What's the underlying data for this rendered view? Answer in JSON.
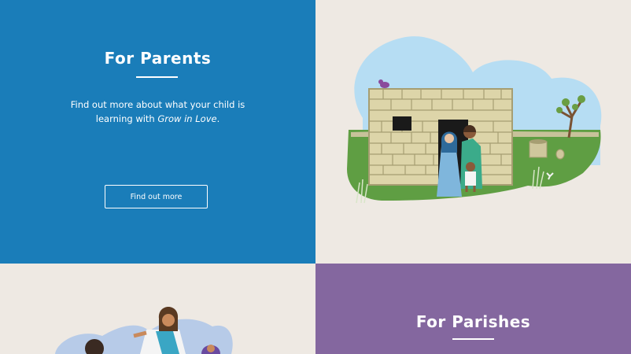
{
  "parents": {
    "heading": "For Parents",
    "desc_part1": "Find out more about what your child is learning with ",
    "desc_italic": "Grow in Love",
    "desc_end": ".",
    "button_label": "Find out more"
  },
  "parishes": {
    "heading": "For Parishes"
  },
  "colors": {
    "parents_bg": "#1a7db9",
    "parishes_bg": "#84679f",
    "neutral_bg": "#eee9e3"
  }
}
